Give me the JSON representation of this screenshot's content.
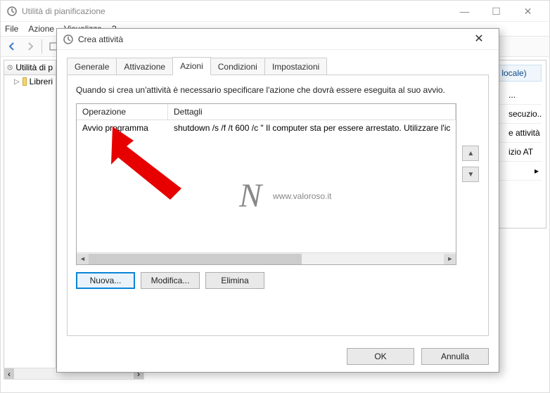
{
  "main_window": {
    "title": "Utilità di pianificazione",
    "menu": {
      "file": "File",
      "action": "Azione",
      "view": "Visualizza",
      "help": "?"
    },
    "tree": {
      "root": "Utilità di p",
      "lib": "Libreri"
    }
  },
  "actions_pane": {
    "header": "r locale)",
    "items": [
      "...",
      "secuzio...",
      "e attività",
      "izio AT",
      "▸"
    ]
  },
  "dialog": {
    "title": "Crea attività",
    "tabs": {
      "general": "Generale",
      "triggers": "Attivazione",
      "actions": "Azioni",
      "conditions": "Condizioni",
      "settings": "Impostazioni"
    },
    "instruction": "Quando si crea un'attività è necessario specificare l'azione che dovrà essere eseguita al suo avvio.",
    "columns": {
      "operation": "Operazione",
      "details": "Dettagli"
    },
    "row": {
      "operation": "Avvio programma",
      "details": "shutdown /s /f /t 600 /c \" Il computer sta per essere arrestato. Utilizzare l'ic"
    },
    "buttons": {
      "new": "Nuova...",
      "edit": "Modifica...",
      "delete": "Elimina",
      "ok": "OK",
      "cancel": "Annulla"
    }
  },
  "watermark": {
    "logo": "N",
    "url": "www.valoroso.it"
  }
}
